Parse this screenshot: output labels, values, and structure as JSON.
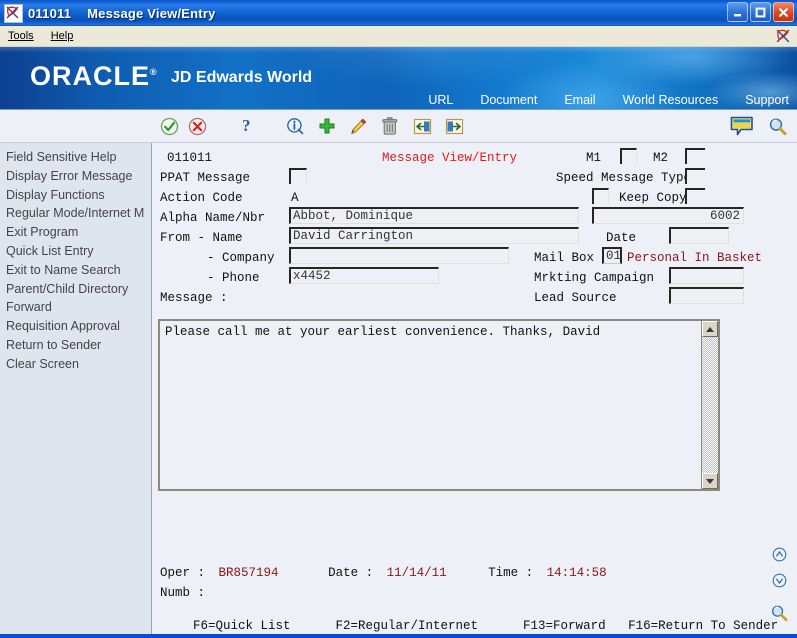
{
  "window": {
    "program_id": "011011",
    "title": "Message View/Entry",
    "minimize_label": "Minimize",
    "maximize_label": "Maximize",
    "close_label": "Close"
  },
  "menubar": {
    "items": [
      {
        "label": "Tools"
      },
      {
        "label": "Help"
      }
    ]
  },
  "banner": {
    "brand": "ORACLE",
    "brand_mark": "®",
    "product": "JD Edwards World",
    "nav": [
      {
        "label": "URL"
      },
      {
        "label": "Document"
      },
      {
        "label": "Email"
      },
      {
        "label": "World Resources"
      },
      {
        "label": "Support"
      }
    ]
  },
  "toolbar": {
    "items": [
      {
        "name": "accept-icon",
        "label": "Accept"
      },
      {
        "name": "cancel-icon",
        "label": "Cancel"
      },
      {
        "name": "help-icon",
        "label": "Help"
      },
      {
        "name": "info-icon",
        "label": "Info"
      },
      {
        "name": "add-icon",
        "label": "Add"
      },
      {
        "name": "edit-icon",
        "label": "Edit"
      },
      {
        "name": "delete-icon",
        "label": "Delete"
      },
      {
        "name": "previous-icon",
        "label": "Previous"
      },
      {
        "name": "next-icon",
        "label": "Next"
      }
    ],
    "right_items": [
      {
        "name": "note-icon",
        "label": "Notes"
      },
      {
        "name": "search-icon",
        "label": "Search"
      }
    ]
  },
  "sidebar": {
    "items": [
      {
        "label": "Field Sensitive Help"
      },
      {
        "label": "Display Error Message"
      },
      {
        "label": "Display Functions"
      },
      {
        "label": "Regular Mode/Internet M"
      },
      {
        "label": "Exit Program"
      },
      {
        "label": "Quick List Entry"
      },
      {
        "label": "Exit to Name Search"
      },
      {
        "label": "Parent/Child Directory"
      },
      {
        "label": "Forward"
      },
      {
        "label": "Requisition Approval"
      },
      {
        "label": "Return to Sender"
      },
      {
        "label": "Clear Screen"
      }
    ]
  },
  "form": {
    "screen_id": "011011",
    "screen_title": "Message View/Entry",
    "labels": {
      "ppat_message": "PPAT Message",
      "action_code": "Action Code",
      "alpha_name": "Alpha Name/Nbr",
      "from_name": "From - Name",
      "from_company": "- Company",
      "from_phone": "- Phone",
      "message": "Message :",
      "m1": "M1",
      "m2": "M2",
      "speed_message_type": "Speed Message Type",
      "keep_copy": "Keep Copy",
      "date": "Date",
      "mail_box": "Mail Box",
      "mrkting_campaign": "Mrkting Campaign",
      "lead_source": "Lead Source"
    },
    "values": {
      "ppat_message": "",
      "action_code": "A",
      "alpha_name": "Abbot, Dominique",
      "alpha_nbr": "",
      "from_name": "David Carrington",
      "from_company": "",
      "from_phone": "x4452",
      "m1": "",
      "m2": "",
      "speed_message_type": "",
      "keep_copy": "",
      "message_number": "6002",
      "date": "",
      "mail_box": "01",
      "mail_box_desc": "Personal In Basket",
      "mrkting_campaign": "",
      "lead_source": ""
    },
    "message_body": "Please call me at your earliest convenience. Thanks, David"
  },
  "status": {
    "oper_label": "Oper :",
    "oper_value": "BR857194",
    "date_label": "Date :",
    "date_value": "11/14/11",
    "time_label": "Time :",
    "time_value": "14:14:58",
    "numb_label": "Numb :",
    "numb_value": ""
  },
  "function_keys": {
    "line": "F6=Quick List      F2=Regular/Internet      F13=Forward   F16=Return To Sender"
  },
  "colors": {
    "title_red": "#e01b1b",
    "value_dark_red": "#8c1515",
    "banner_blue": "#1271c6",
    "window_frame": "#0050d0",
    "sidebar_bg": "#dfe5ee",
    "content_bg": "#eef0f8"
  }
}
